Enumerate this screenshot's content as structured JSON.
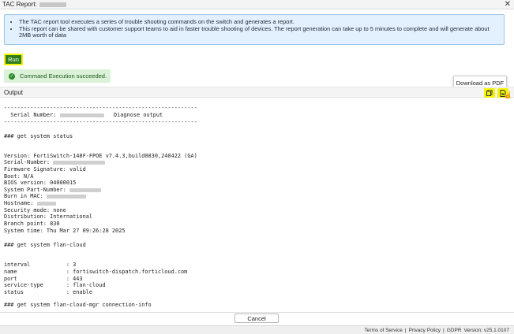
{
  "window": {
    "title": "TAC Report:",
    "close_glyph": "✕"
  },
  "info": {
    "items": [
      "The TAC report tool executes a series of trouble shooting commands on the switch and generates a report.",
      "This report can be shared with customer support teams to aid in faster trouble shooting of devices. The report generation can take up to 5 minutes to complete and will generate about 2MB worth of data"
    ]
  },
  "actions": {
    "run_label": "Run",
    "success_message": "Command Execution succeeded.",
    "success_icon": "check-circle-icon"
  },
  "tooltip": {
    "text": "Download as PDF"
  },
  "output": {
    "title": "Output",
    "copy_icon": "copy-icon",
    "pdf_icon": "pdf-download-icon",
    "lines": {
      "l01": "-----------------------------------------------------------",
      "l02a": "  Serial Number: ",
      "l02b": "   Diagnose output",
      "l03": "-----------------------------------------------------------",
      "l04": "### get system status",
      "l05": "Version: FortiSwitch-148F-FPOE v7.4.3,build0830,240422 (GA)",
      "l06": "Serial-Number: ",
      "l07": "Firmware Signature: valid",
      "l08": "Boot: N/A",
      "l09": "BIOS version: 04000015",
      "l10": "System Part-Number: ",
      "l11": "Burn in MAC: ",
      "l12": "Hostname: ",
      "l13": "Security mode: none",
      "l14": "Distribution: International",
      "l15": "Branch point: 830",
      "l16": "System time: Thu Mar 27 09:26:28 2025",
      "l17": "### get system flan-cloud",
      "l18": "interval           : 3",
      "l19": "name               : fortiswitch-dispatch.forticloud.com",
      "l20": "port               : 443",
      "l21": "service-type       : flan-cloud",
      "l22": "status             : enable",
      "l23": "### get system flan-cloud-mgr connection-info"
    }
  },
  "footer": {
    "cancel_label": "Cancel"
  },
  "status_bar": {
    "terms": "Terms of Service",
    "sep1": "|",
    "privacy": "Privacy Policy",
    "sep2": "|",
    "gdpr": "GDPR",
    "version": "Version: v25.1.0107"
  },
  "colors": {
    "run_button": "#2f7d1c",
    "highlight": "#f3f30a",
    "info_background": "#e3f0fd",
    "success_background": "#dbf2d9"
  }
}
